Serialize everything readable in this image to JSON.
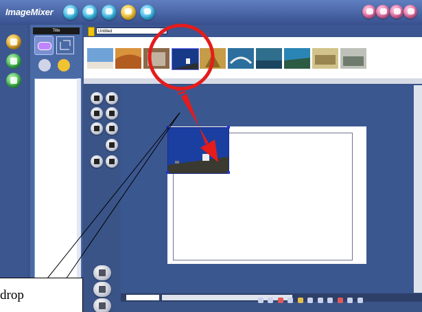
{
  "app": {
    "logo_text": "ImageMixer",
    "accent_color": "#3a5488",
    "title_buttons": [
      "capture-icon",
      "album-icon",
      "print-icon",
      "edit-icon",
      "share-icon"
    ],
    "system_buttons": [
      "minimize-icon",
      "help-icon",
      "tools-icon",
      "close-icon"
    ]
  },
  "dock": {
    "items": [
      "album-mode-icon",
      "create-mode-icon",
      "output-mode-icon"
    ]
  },
  "title_panel": {
    "tab_label": "Title",
    "styles": [
      "pill-title-style",
      "frame-title-style"
    ]
  },
  "filmstrip": {
    "album_select_value": "Untitled",
    "thumbnails": [
      "beach",
      "desert",
      "city-building",
      "observatory",
      "pyramid",
      "bridge",
      "lake",
      "coast",
      "buildings",
      "marketplace"
    ],
    "selected_index": 3
  },
  "tools": {
    "rows": [
      [
        "flip-icon",
        "rotate-icon"
      ],
      [
        "crop-icon",
        "frame-icon"
      ],
      [
        "layer-icon",
        "effect-icon"
      ],
      [
        "lock-icon"
      ],
      [
        "front-icon",
        "back-icon"
      ]
    ],
    "lower": [
      "text-icon",
      "stamp-icon",
      "image-icon"
    ]
  },
  "canvas": {
    "selected_photo": "observatory"
  },
  "annotation": {
    "callout_text": "drop"
  }
}
